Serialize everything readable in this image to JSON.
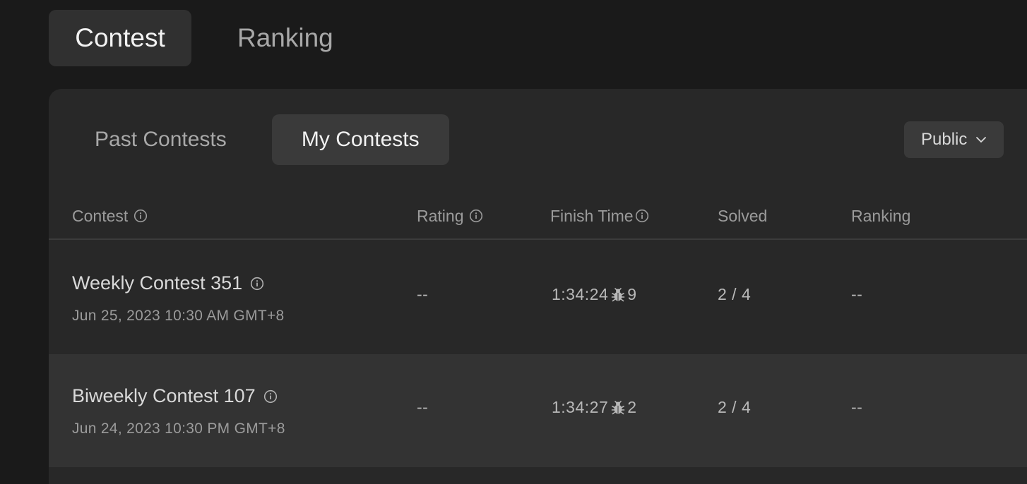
{
  "top_tabs": [
    {
      "label": "Contest",
      "active": true
    },
    {
      "label": "Ranking",
      "active": false
    }
  ],
  "sub_tabs": [
    {
      "label": "Past Contests",
      "active": false
    },
    {
      "label": "My Contests",
      "active": true
    }
  ],
  "visibility": {
    "selected": "Public",
    "icon": "chevron-down-icon"
  },
  "table": {
    "headers": {
      "contest": "Contest",
      "rating": "Rating",
      "finish_time": "Finish Time",
      "solved": "Solved",
      "ranking": "Ranking"
    },
    "rows": [
      {
        "name": "Weekly Contest 351",
        "date": "Jun 25, 2023 10:30 AM GMT+8",
        "rating": "--",
        "finish_time": "1:34:24",
        "bugs": "9",
        "solved": "2 / 4",
        "ranking": "--"
      },
      {
        "name": "Biweekly Contest 107",
        "date": "Jun 24, 2023 10:30 PM GMT+8",
        "rating": "--",
        "finish_time": "1:34:27",
        "bugs": "2",
        "solved": "2 / 4",
        "ranking": "--"
      }
    ]
  },
  "colors": {
    "background": "#1a1a1a",
    "panel": "#282828",
    "active_tab": "#303030",
    "row_alt": "#333333"
  }
}
